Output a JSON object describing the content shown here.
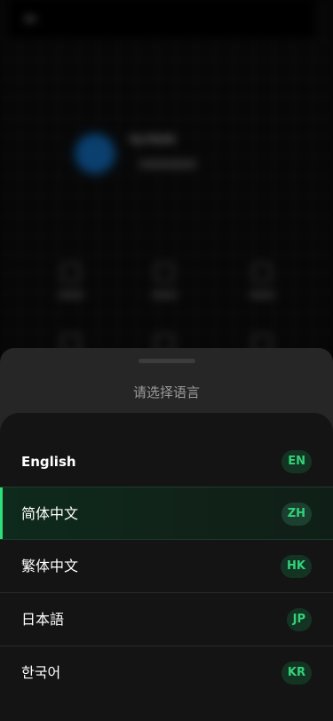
{
  "background": {
    "back_icon": "arrow-left-icon",
    "profile_name": "NyONdN"
  },
  "sheet": {
    "title": "请选择语言",
    "languages": [
      {
        "name": "English",
        "code": "EN",
        "selected": false
      },
      {
        "name": "简体中文",
        "code": "ZH",
        "selected": true
      },
      {
        "name": "繁体中文",
        "code": "HK",
        "selected": false
      },
      {
        "name": "日本語",
        "code": "JP",
        "selected": false
      },
      {
        "name": "한국어",
        "code": "KR",
        "selected": false
      }
    ]
  },
  "colors": {
    "accent": "#2ee07a",
    "badge_text": "#34d17a",
    "sheet_bg": "#262626",
    "list_bg": "#141414"
  }
}
